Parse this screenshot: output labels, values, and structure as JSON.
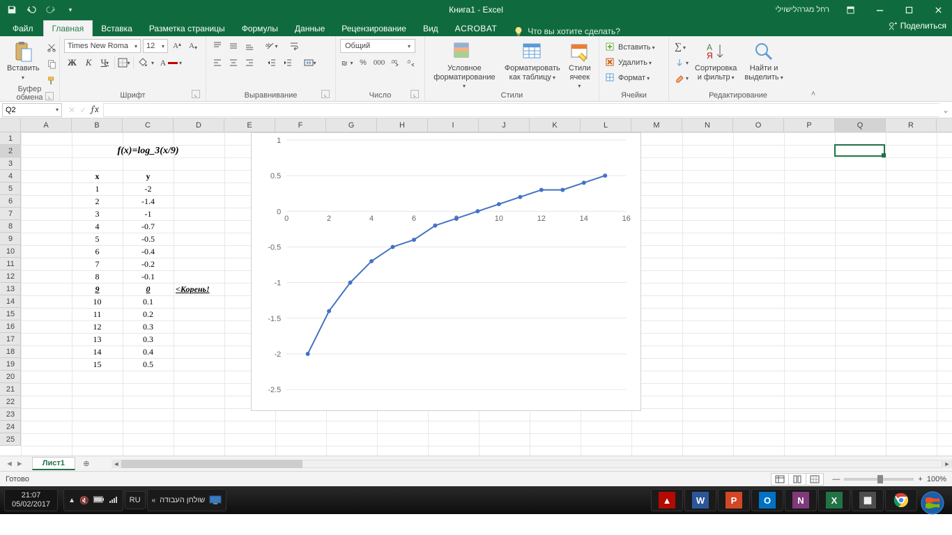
{
  "title": "Книга1  -  Excel",
  "user_name": "רחל מגרהלישוילי",
  "tabs": {
    "file": "Файл",
    "home": "Главная",
    "insert": "Вставка",
    "layout": "Разметка страницы",
    "formulas": "Формулы",
    "data": "Данные",
    "review": "Рецензирование",
    "view": "Вид",
    "acrobat": "ACROBAT",
    "tell_me": "Что вы хотите сделать?"
  },
  "share": "Поделиться",
  "ribbon": {
    "clipboard": {
      "paste": "Вставить",
      "label": "Буфер обмена"
    },
    "font": {
      "name": "Times New Roma",
      "size": "12",
      "bold": "Ж",
      "italic": "К",
      "underline": "Ч",
      "label": "Шрифт"
    },
    "alignment": {
      "label": "Выравнивание"
    },
    "number": {
      "format": "Общий",
      "label": "Число"
    },
    "styles": {
      "cond": "Условное\nформатирование",
      "table": "Форматировать\nкак таблицу",
      "cell": "Стили\nячеек",
      "label": "Стили"
    },
    "cells": {
      "insert": "Вставить",
      "delete": "Удалить",
      "format": "Формат",
      "label": "Ячейки"
    },
    "editing": {
      "sort": "Сортировка\nи фильтр",
      "find": "Найти и\nвыделить",
      "label": "Редактирование"
    }
  },
  "namebox": "Q2",
  "columns": [
    "A",
    "B",
    "C",
    "D",
    "E",
    "F",
    "G",
    "H",
    "I",
    "J",
    "K",
    "L",
    "M",
    "N",
    "O",
    "P",
    "Q",
    "R"
  ],
  "formula_title": "f(x)=log_3(x/9)",
  "header_x": "x",
  "header_y": "y",
  "root_label": "<Корень!",
  "data_rows": [
    {
      "r": 5,
      "x": "1",
      "y": "-2"
    },
    {
      "r": 6,
      "x": "2",
      "y": "-1.4"
    },
    {
      "r": 7,
      "x": "3",
      "y": "-1"
    },
    {
      "r": 8,
      "x": "4",
      "y": "-0.7"
    },
    {
      "r": 9,
      "x": "5",
      "y": "-0.5"
    },
    {
      "r": 10,
      "x": "6",
      "y": "-0.4"
    },
    {
      "r": 11,
      "x": "7",
      "y": "-0.2"
    },
    {
      "r": 12,
      "x": "8",
      "y": "-0.1"
    },
    {
      "r": 13,
      "x": "9",
      "y": "0",
      "root": true
    },
    {
      "r": 14,
      "x": "10",
      "y": "0.1"
    },
    {
      "r": 15,
      "x": "11",
      "y": "0.2"
    },
    {
      "r": 16,
      "x": "12",
      "y": "0.3"
    },
    {
      "r": 17,
      "x": "13",
      "y": "0.3"
    },
    {
      "r": 18,
      "x": "14",
      "y": "0.4"
    },
    {
      "r": 19,
      "x": "15",
      "y": "0.5"
    }
  ],
  "chart_data": {
    "type": "line",
    "x": [
      1,
      2,
      3,
      4,
      5,
      6,
      7,
      8,
      9,
      10,
      11,
      12,
      13,
      14,
      15
    ],
    "values": [
      -2,
      -1.4,
      -1,
      -0.7,
      -0.5,
      -0.4,
      -0.2,
      -0.1,
      0,
      0.1,
      0.2,
      0.3,
      0.3,
      0.4,
      0.5
    ],
    "xlim": [
      0,
      16
    ],
    "ylim": [
      -2.5,
      1
    ],
    "xticks": [
      0,
      2,
      4,
      6,
      8,
      10,
      12,
      14,
      16
    ],
    "yticks": [
      -2.5,
      -2,
      -1.5,
      -1,
      -0.5,
      0,
      0.5,
      1
    ],
    "title": "",
    "xlabel": "",
    "ylabel": ""
  },
  "sheet_tab": "Лист1",
  "status_ready": "Готово",
  "zoom_pct": "100%",
  "taskbar": {
    "time": "21:07",
    "date": "05/02/2017",
    "lang": "RU",
    "desktop_label": "שולחן העבודה"
  },
  "apps": {
    "pdf": "",
    "word": "W",
    "ppt": "P",
    "outlook": "O",
    "onenote": "N",
    "excel": "X",
    "other": ""
  }
}
